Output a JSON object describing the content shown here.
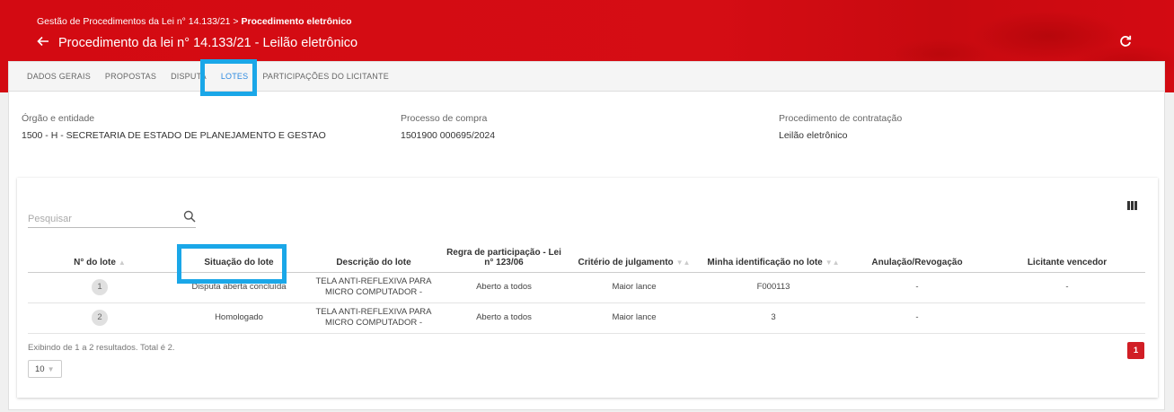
{
  "header": {
    "breadcrumb_prefix": "Gestão de Procedimentos da Lei n° 14.133/21 > ",
    "breadcrumb_current": "Procedimento eletrônico",
    "title": "Procedimento da lei n° 14.133/21 - Leilão eletrônico",
    "back_icon": "arrow-left-icon",
    "refresh_icon": "refresh-icon"
  },
  "tabs": [
    {
      "label": "DADOS GERAIS"
    },
    {
      "label": "PROPOSTAS"
    },
    {
      "label": "DISPUTA"
    },
    {
      "label": "LOTES"
    },
    {
      "label": "PARTICIPAÇÕES DO LICITANTE"
    }
  ],
  "info": {
    "orgao_label": "Órgão e entidade",
    "orgao_value": "1500 - H - SECRETARIA DE ESTADO DE PLANEJAMENTO E GESTAO",
    "processo_label": "Processo de compra",
    "processo_value": "1501900 000695/2024",
    "procedimento_label": "Procedimento de contratação",
    "procedimento_value": "Leilão eletrônico"
  },
  "search": {
    "placeholder": "Pesquisar"
  },
  "table": {
    "headers": [
      "N° do lote",
      "Situação do lote",
      "Descrição do lote",
      "Regra de participação - Lei n° 123/06",
      "Critério de julgamento",
      "Minha identificação no lote",
      "Anulação/Revogação",
      "Licitante vencedor"
    ],
    "rows": [
      {
        "lote": "1",
        "situacao": "Disputa aberta concluída",
        "descricao": "TELA ANTI-REFLEXIVA PARA MICRO COMPUTADOR -",
        "regra": "Aberto a todos",
        "criterio": "Maior lance",
        "identificacao": "F000113",
        "anulacao": "-",
        "vencedor": "-"
      },
      {
        "lote": "2",
        "situacao": "Homologado",
        "descricao": "TELA ANTI-REFLEXIVA PARA MICRO COMPUTADOR -",
        "regra": "Aberto a todos",
        "criterio": "Maior lance",
        "identificacao": "3",
        "anulacao": "-",
        "vencedor": ""
      }
    ]
  },
  "footer": {
    "results_text": "Exibindo de 1 a 2 resultados. Total é 2.",
    "page_size": "10",
    "current_page": "1"
  },
  "colors": {
    "brand_red": "#d30a12",
    "active_tab": "#2d8ae0",
    "highlight": "#1aa7e8"
  }
}
